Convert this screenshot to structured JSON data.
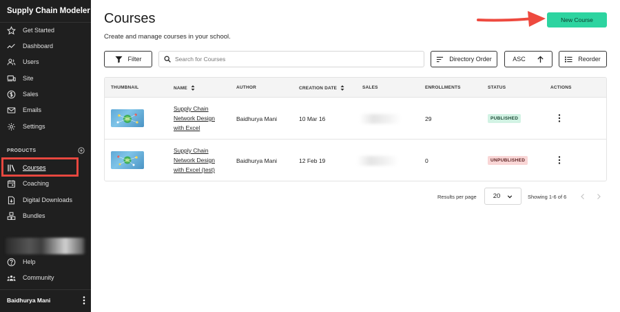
{
  "sidebar": {
    "brand": "Supply Chain Modeler",
    "nav": [
      {
        "label": "Get Started",
        "icon": "star-icon"
      },
      {
        "label": "Dashboard",
        "icon": "trend-line-icon"
      },
      {
        "label": "Users",
        "icon": "users-icon"
      },
      {
        "label": "Site",
        "icon": "devices-icon"
      },
      {
        "label": "Sales",
        "icon": "dollar-icon"
      },
      {
        "label": "Emails",
        "icon": "mail-icon"
      },
      {
        "label": "Settings",
        "icon": "gear-icon"
      }
    ],
    "products_label": "PRODUCTS",
    "products": [
      {
        "label": "Courses",
        "icon": "library-icon",
        "active": true
      },
      {
        "label": "Coaching",
        "icon": "calendar-icon"
      },
      {
        "label": "Digital Downloads",
        "icon": "download-file-icon"
      },
      {
        "label": "Bundles",
        "icon": "bundle-icon"
      }
    ],
    "footer_nav": [
      {
        "label": "Help",
        "icon": "help-icon"
      },
      {
        "label": "Community",
        "icon": "community-icon"
      }
    ],
    "user_name": "Baidhurya Mani"
  },
  "header": {
    "title": "Courses",
    "subtitle": "Create and manage courses in your school.",
    "new_course_label": "New Course"
  },
  "toolbar": {
    "filter_label": "Filter",
    "search_placeholder": "Search for Courses",
    "directory_order_label": "Directory Order",
    "asc_label": "ASC",
    "reorder_label": "Reorder"
  },
  "table": {
    "columns": [
      "THUMBNAIL",
      "NAME",
      "AUTHOR",
      "CREATION DATE",
      "SALES",
      "ENROLLMENTS",
      "STATUS",
      "ACTIONS"
    ],
    "rows": [
      {
        "name_lines": [
          "Supply Chain",
          "Network Design",
          "with Excel"
        ],
        "author": "Baidhurya Mani",
        "created": "10 Mar 16",
        "enrollments": "29",
        "status": "PUBLISHED"
      },
      {
        "name_lines": [
          "Supply Chain",
          "Network Design",
          "with Excel (test)"
        ],
        "author": "Baidhurya Mani",
        "created": "12 Feb 19",
        "enrollments": "0",
        "status": "UNPUBLISHED"
      }
    ]
  },
  "pagination": {
    "results_per_page_label": "Results per page",
    "results_per_page": "20",
    "showing": "Showing 1-6 of 6"
  },
  "colors": {
    "sidebar_bg": "#1f1f1f",
    "primary_button": "#2dd4a0",
    "highlight": "#e8473f",
    "published_badge": "#d2f3e4",
    "unpublished_badge": "#f9d6d6"
  }
}
